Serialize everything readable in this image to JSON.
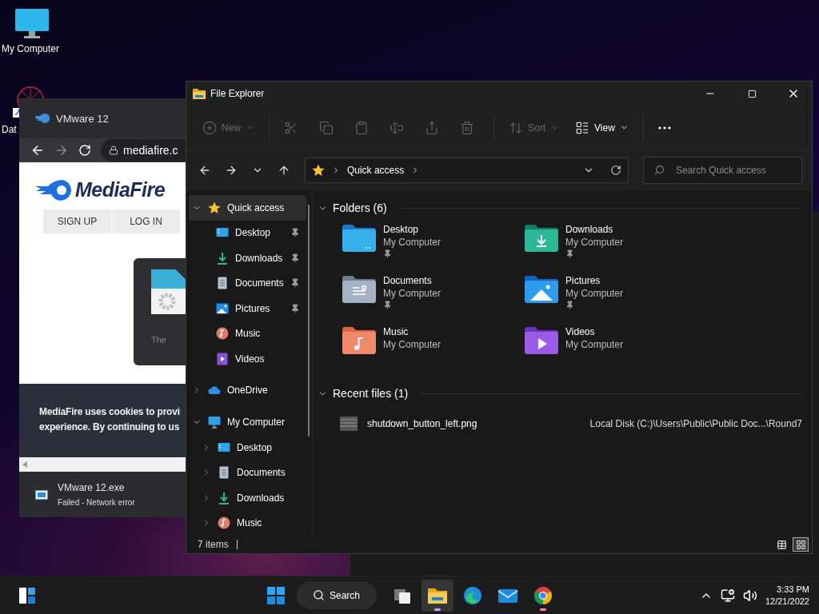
{
  "desktop_icons": [
    {
      "kind": "computer",
      "label": "My Computer"
    },
    {
      "kind": "shortcut",
      "label": "Dat"
    }
  ],
  "browser": {
    "tab_title": "VMware 12",
    "address": "mediafire.c",
    "logo": "MediaFire",
    "buttons": [
      "SIGN UP",
      "LOG IN"
    ],
    "card_text": "The",
    "cookie_lines": [
      "MediaFire uses cookies to provi",
      "experience. By continuing to us"
    ],
    "download": {
      "name": "VMware 12.exe",
      "status": "Failed - Network error"
    }
  },
  "explorer": {
    "title": "File Explorer",
    "toolbar": [
      {
        "kind": "new",
        "label": "New",
        "disabled": true
      },
      {
        "kind": "cut",
        "disabled": true
      },
      {
        "kind": "copy",
        "disabled": true
      },
      {
        "kind": "paste",
        "disabled": true
      },
      {
        "kind": "rename",
        "disabled": true
      },
      {
        "kind": "share",
        "disabled": true
      },
      {
        "kind": "delete",
        "disabled": true
      },
      {
        "kind": "sort",
        "label": "Sort",
        "disabled": true
      },
      {
        "kind": "view",
        "label": "View",
        "disabled": false
      },
      {
        "kind": "more",
        "disabled": false
      }
    ],
    "address": {
      "crumbs": [
        "Quick access"
      ]
    },
    "search": {
      "placeholder": "Search Quick access"
    },
    "nav": [
      {
        "kind": "star",
        "label": "Quick access",
        "expanded": true,
        "selected": true,
        "children": [
          {
            "kind": "desktop",
            "label": "Desktop",
            "pinned": true,
            "selected": false
          },
          {
            "kind": "downloads",
            "label": "Downloads",
            "pinned": true,
            "selected": false
          },
          {
            "kind": "documents",
            "label": "Documents",
            "pinned": true,
            "selected": false
          },
          {
            "kind": "pictures",
            "label": "Pictures",
            "pinned": true,
            "selected": false
          },
          {
            "kind": "music",
            "label": "Music",
            "pinned": false,
            "selected": false
          },
          {
            "kind": "videos",
            "label": "Videos",
            "pinned": false,
            "selected": false
          }
        ]
      },
      {
        "kind": "cloud",
        "label": "OneDrive",
        "expanded": false,
        "selected": false
      },
      {
        "kind": "computer",
        "label": "My Computer",
        "expanded": true,
        "selected": false,
        "children": [
          {
            "kind": "desktop",
            "label": "Desktop",
            "expanded": false,
            "selected": false
          },
          {
            "kind": "documents",
            "label": "Documents",
            "expanded": false,
            "selected": false
          },
          {
            "kind": "downloads",
            "label": "Downloads",
            "expanded": false,
            "selected": false
          },
          {
            "kind": "music",
            "label": "Music",
            "expanded": false,
            "selected": false
          }
        ]
      }
    ],
    "folders_section": {
      "title": "Folders (6)",
      "expanded": true
    },
    "folders": [
      {
        "kind": "desktop",
        "name": "Desktop",
        "location": "My Computer",
        "pinned": true
      },
      {
        "kind": "downloads",
        "name": "Downloads",
        "location": "My Computer",
        "pinned": true
      },
      {
        "kind": "documents",
        "name": "Documents",
        "location": "My Computer",
        "pinned": true
      },
      {
        "kind": "pictures",
        "name": "Pictures",
        "location": "My Computer",
        "pinned": true
      },
      {
        "kind": "music",
        "name": "Music",
        "location": "My Computer",
        "pinned": false
      },
      {
        "kind": "videos",
        "name": "Videos",
        "location": "My Computer",
        "pinned": false
      }
    ],
    "recent_section": {
      "title": "Recent files (1)",
      "expanded": true
    },
    "recent_files": [
      {
        "name": "shutdown_button_left.png",
        "path": "Local Disk (C:)\\Users\\Public\\Public Doc...\\Round7"
      }
    ],
    "status": "7 items",
    "view_modes": [
      {
        "kind": "details",
        "selected": false
      },
      {
        "kind": "tiles",
        "selected": true
      }
    ]
  },
  "taskbar": {
    "search": "Search",
    "apps": [
      {
        "kind": "start",
        "running": false,
        "selected": false
      },
      {
        "kind": "taskview",
        "running": false,
        "selected": false
      },
      {
        "kind": "explorer",
        "running": true,
        "selected": true
      },
      {
        "kind": "edge",
        "running": false,
        "selected": false
      },
      {
        "kind": "mail",
        "running": false,
        "selected": false
      },
      {
        "kind": "chrome",
        "running": true,
        "selected": false
      }
    ],
    "time": "3:33 PM",
    "date": "12/21/2022"
  }
}
